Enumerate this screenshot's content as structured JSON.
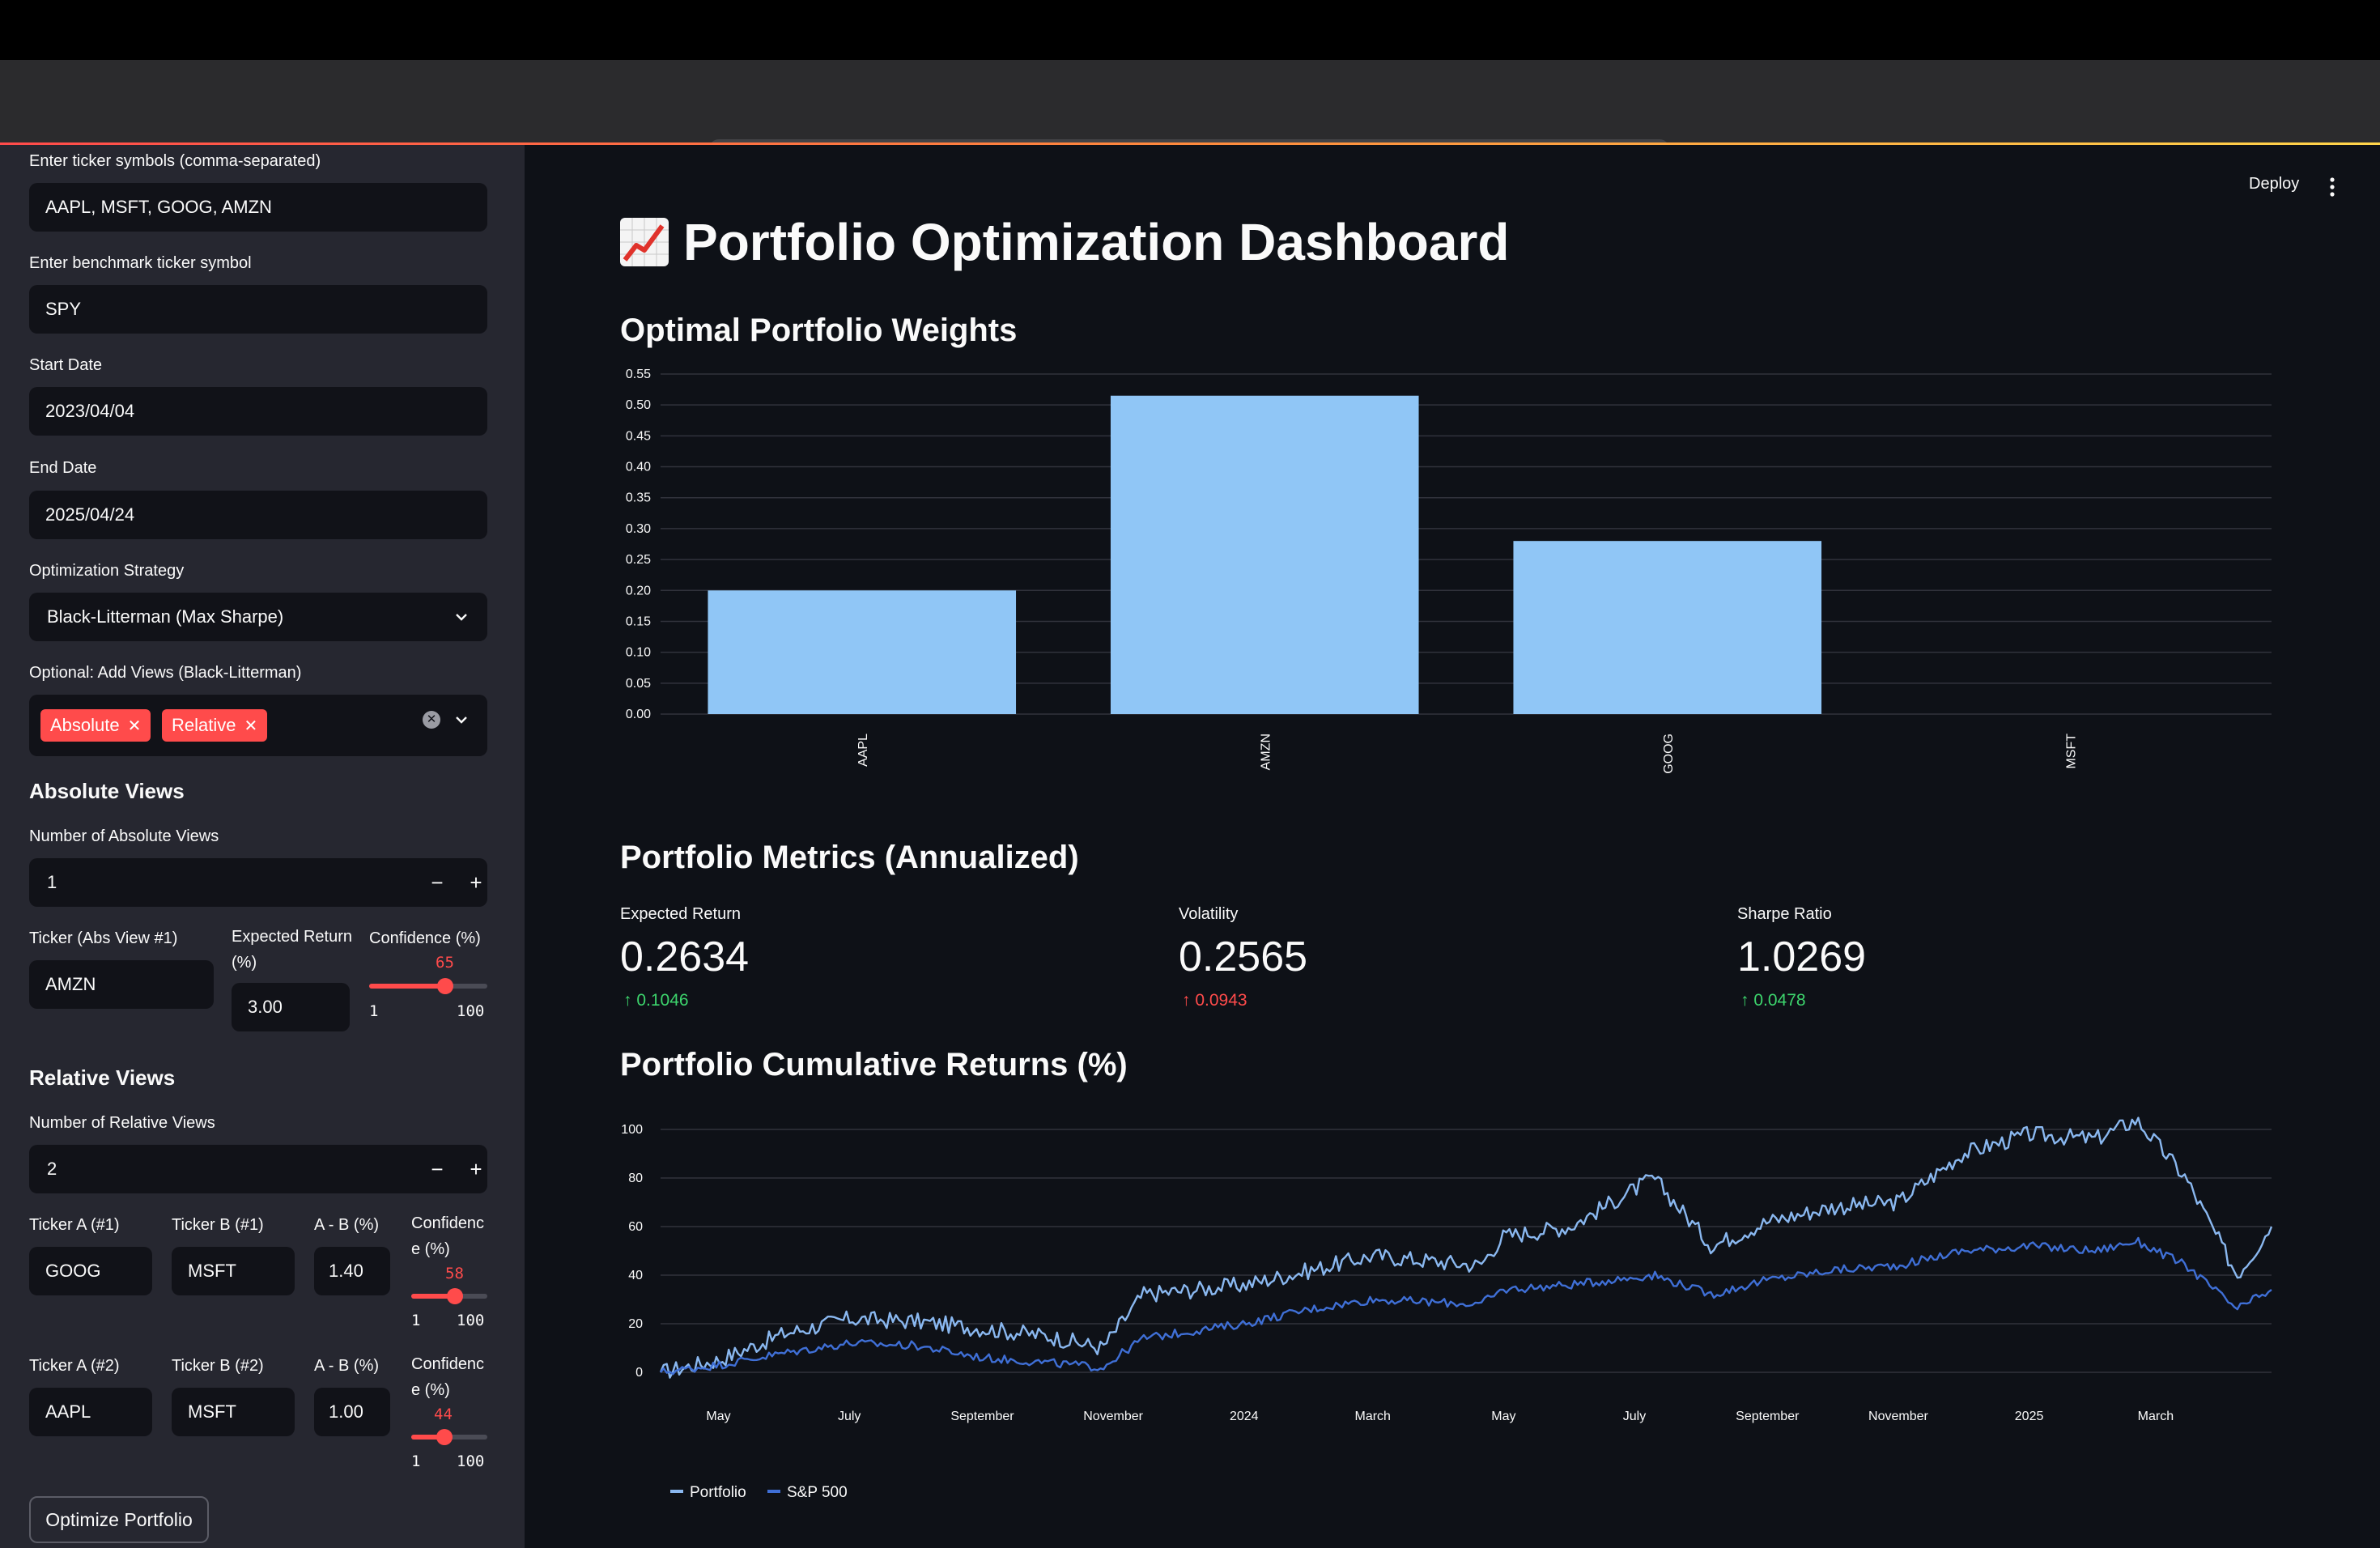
{
  "browser": {
    "url": "localhost"
  },
  "app": {
    "title": "Portfolio Optimization Dashboard",
    "deploy_label": "Deploy"
  },
  "sidebar": {
    "tickers_label": "Enter ticker symbols (comma-separated)",
    "tickers_value": "AAPL, MSFT, GOOG, AMZN",
    "benchmark_label": "Enter benchmark ticker symbol",
    "benchmark_value": "SPY",
    "start_label": "Start Date",
    "start_value": "2023/04/04",
    "end_label": "End Date",
    "end_value": "2025/04/24",
    "strategy_label": "Optimization Strategy",
    "strategy_value": "Black-Litterman (Max Sharpe)",
    "views_label": "Optional: Add Views (Black-Litterman)",
    "views_chips": [
      "Absolute",
      "Relative"
    ],
    "absolute": {
      "heading": "Absolute Views",
      "count_label": "Number of Absolute Views",
      "count_value": "1",
      "rows": [
        {
          "ticker_label": "Ticker (Abs View #1)",
          "ticker_value": "AMZN",
          "return_label_1": "Expected Return",
          "return_label_2": "(%)",
          "return_value": "3.00",
          "conf_label": "Confidence (%)",
          "conf_value": 65,
          "conf_min": "1",
          "conf_max": "100"
        }
      ]
    },
    "relative": {
      "heading": "Relative Views",
      "count_label": "Number of Relative Views",
      "count_value": "2",
      "rows": [
        {
          "a_label": "Ticker A (#1)",
          "a_value": "GOOG",
          "b_label": "Ticker B (#1)",
          "b_value": "MSFT",
          "diff_label": "A - B (%)",
          "diff_value": "1.40",
          "conf_label_1": "Confidenc",
          "conf_label_2": "e (%)",
          "conf_value": 58,
          "conf_min": "1",
          "conf_max": "100"
        },
        {
          "a_label": "Ticker A (#2)",
          "a_value": "AAPL",
          "b_label": "Ticker B (#2)",
          "b_value": "MSFT",
          "diff_label": "A - B (%)",
          "diff_value": "1.00",
          "conf_label_1": "Confidenc",
          "conf_label_2": "e (%)",
          "conf_value": 44,
          "conf_min": "1",
          "conf_max": "100"
        }
      ]
    },
    "optimize_label": "Optimize Portfolio"
  },
  "sections": {
    "weights_title": "Optimal Portfolio Weights",
    "metrics_title": "Portfolio Metrics (Annualized)",
    "returns_title": "Portfolio Cumulative Returns (%)"
  },
  "metrics": [
    {
      "label": "Expected Return",
      "value": "0.2634",
      "delta": "0.1046",
      "delta_color": "#3dd56d"
    },
    {
      "label": "Volatility",
      "value": "0.2565",
      "delta": "0.0943",
      "delta_color": "#ff4b4b"
    },
    {
      "label": "Sharpe Ratio",
      "value": "1.0269",
      "delta": "0.0478",
      "delta_color": "#3dd56d"
    }
  ],
  "colors": {
    "accent": "#ff4b4b",
    "bar": "#90c6f6",
    "portfolio_line": "#8ab8f0",
    "benchmark_line": "#3f6fd6"
  },
  "chart_data": [
    {
      "type": "bar",
      "title": "Optimal Portfolio Weights",
      "categories": [
        "AAPL",
        "AMZN",
        "GOOG",
        "MSFT"
      ],
      "values": [
        0.2,
        0.515,
        0.28,
        0.0
      ],
      "ylim": [
        0,
        0.55
      ],
      "yticks": [
        "0.00",
        "0.05",
        "0.10",
        "0.15",
        "0.20",
        "0.25",
        "0.30",
        "0.35",
        "0.40",
        "0.45",
        "0.50",
        "0.55"
      ],
      "grid": true
    },
    {
      "type": "line",
      "title": "Portfolio Cumulative Returns (%)",
      "x": [
        "2023-04-04",
        "2023-05-01",
        "2023-06-01",
        "2023-07-01",
        "2023-08-01",
        "2023-09-01",
        "2023-10-01",
        "2023-10-27",
        "2023-11-15",
        "2024-01-01",
        "2024-02-01",
        "2024-03-01",
        "2024-04-20",
        "2024-05-01",
        "2024-06-01",
        "2024-07-10",
        "2024-08-06",
        "2024-09-01",
        "2024-10-01",
        "2024-11-01",
        "2024-12-01",
        "2025-01-01",
        "2025-02-01",
        "2025-02-20",
        "2025-03-15",
        "2025-04-08",
        "2025-04-24"
      ],
      "xticks": [
        "May",
        "July",
        "September",
        "November",
        "2024",
        "March",
        "May",
        "July",
        "September",
        "November",
        "2025",
        "March"
      ],
      "yticks": [
        "0",
        "20",
        "40",
        "60",
        "80",
        "100"
      ],
      "ylim": [
        -5,
        105
      ],
      "series": [
        {
          "name": "Portfolio",
          "values": [
            0,
            5,
            16,
            22,
            21,
            18,
            15,
            10,
            32,
            36,
            42,
            48,
            44,
            56,
            60,
            80,
            52,
            62,
            68,
            70,
            90,
            98,
            96,
            104,
            80,
            40,
            60
          ]
        },
        {
          "name": "S&P 500",
          "values": [
            0,
            3,
            8,
            12,
            11,
            6,
            4,
            2,
            14,
            20,
            26,
            30,
            28,
            34,
            36,
            40,
            32,
            38,
            42,
            44,
            50,
            52,
            50,
            54,
            44,
            26,
            34
          ]
        }
      ],
      "legend": "bottom-left"
    }
  ]
}
